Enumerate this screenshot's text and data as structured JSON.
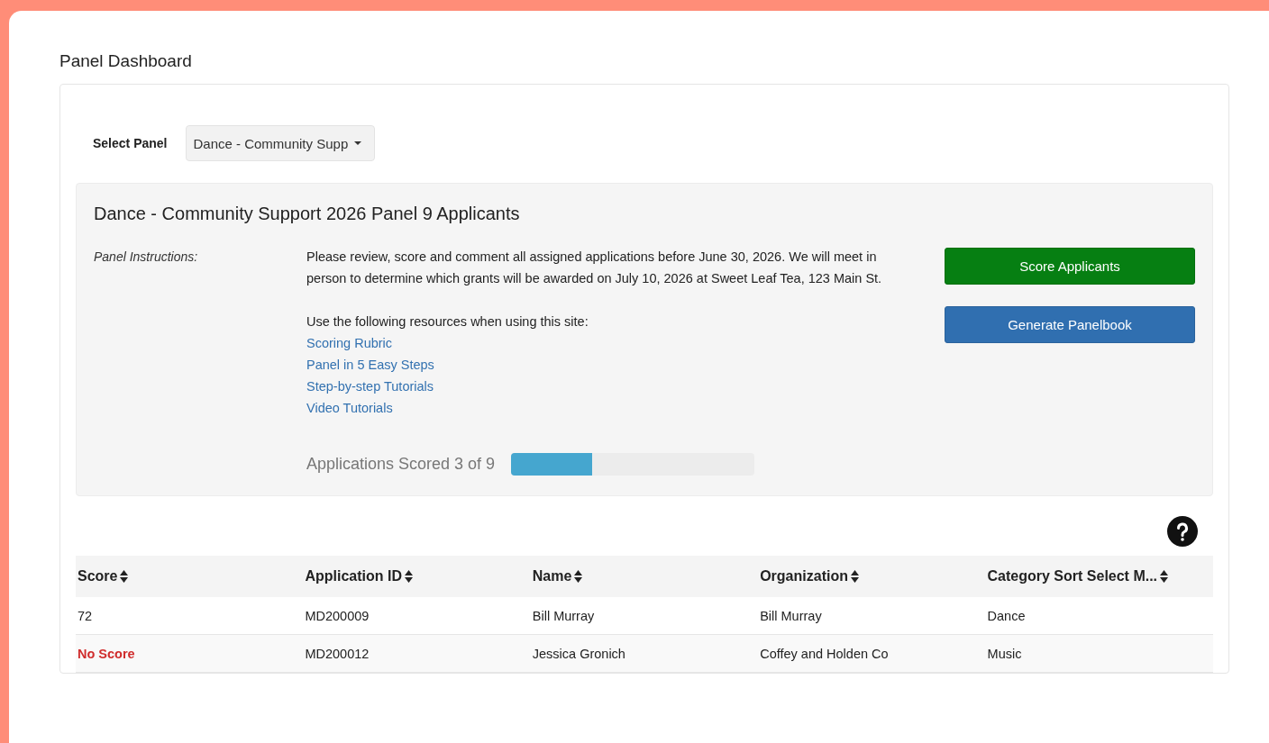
{
  "page_title": "Panel Dashboard",
  "panel_select": {
    "label": "Select Panel",
    "value": "Dance - Community Supp"
  },
  "panel": {
    "heading": "Dance - Community Support 2026 Panel 9 Applicants",
    "instructions_label": "Panel Instructions:",
    "instructions": "Please review, score and comment all assigned applications before June 30, 2026.  We will meet in person to determine which grants will be awarded on July 10, 2026 at Sweet Leaf Tea, 123 Main St.",
    "resources_intro": "Use the following resources when using this site:",
    "resource_links": [
      "Scoring Rubric",
      "Panel in 5 Easy Steps",
      "Step-by-step Tutorials",
      "Video Tutorials"
    ],
    "progress": {
      "label": "Applications Scored 3 of 9",
      "level": 0.333
    },
    "buttons": [
      {
        "label": "Score Applicants",
        "kind": "success"
      },
      {
        "label": "Generate Panelbook",
        "kind": "primary"
      }
    ]
  },
  "table": {
    "columns": [
      "Score",
      "Application ID",
      "Name",
      "Organization",
      "Category Sort Select M..."
    ],
    "rows": [
      {
        "scored": true,
        "cells": [
          "72",
          "MD200009",
          "Bill Murray",
          "Bill Murray",
          "Dance"
        ]
      },
      {
        "scored": false,
        "cells": [
          "No Score",
          "MD200012",
          "Jessica Gronich",
          "Coffey and Holden Co",
          "Music"
        ]
      }
    ]
  }
}
